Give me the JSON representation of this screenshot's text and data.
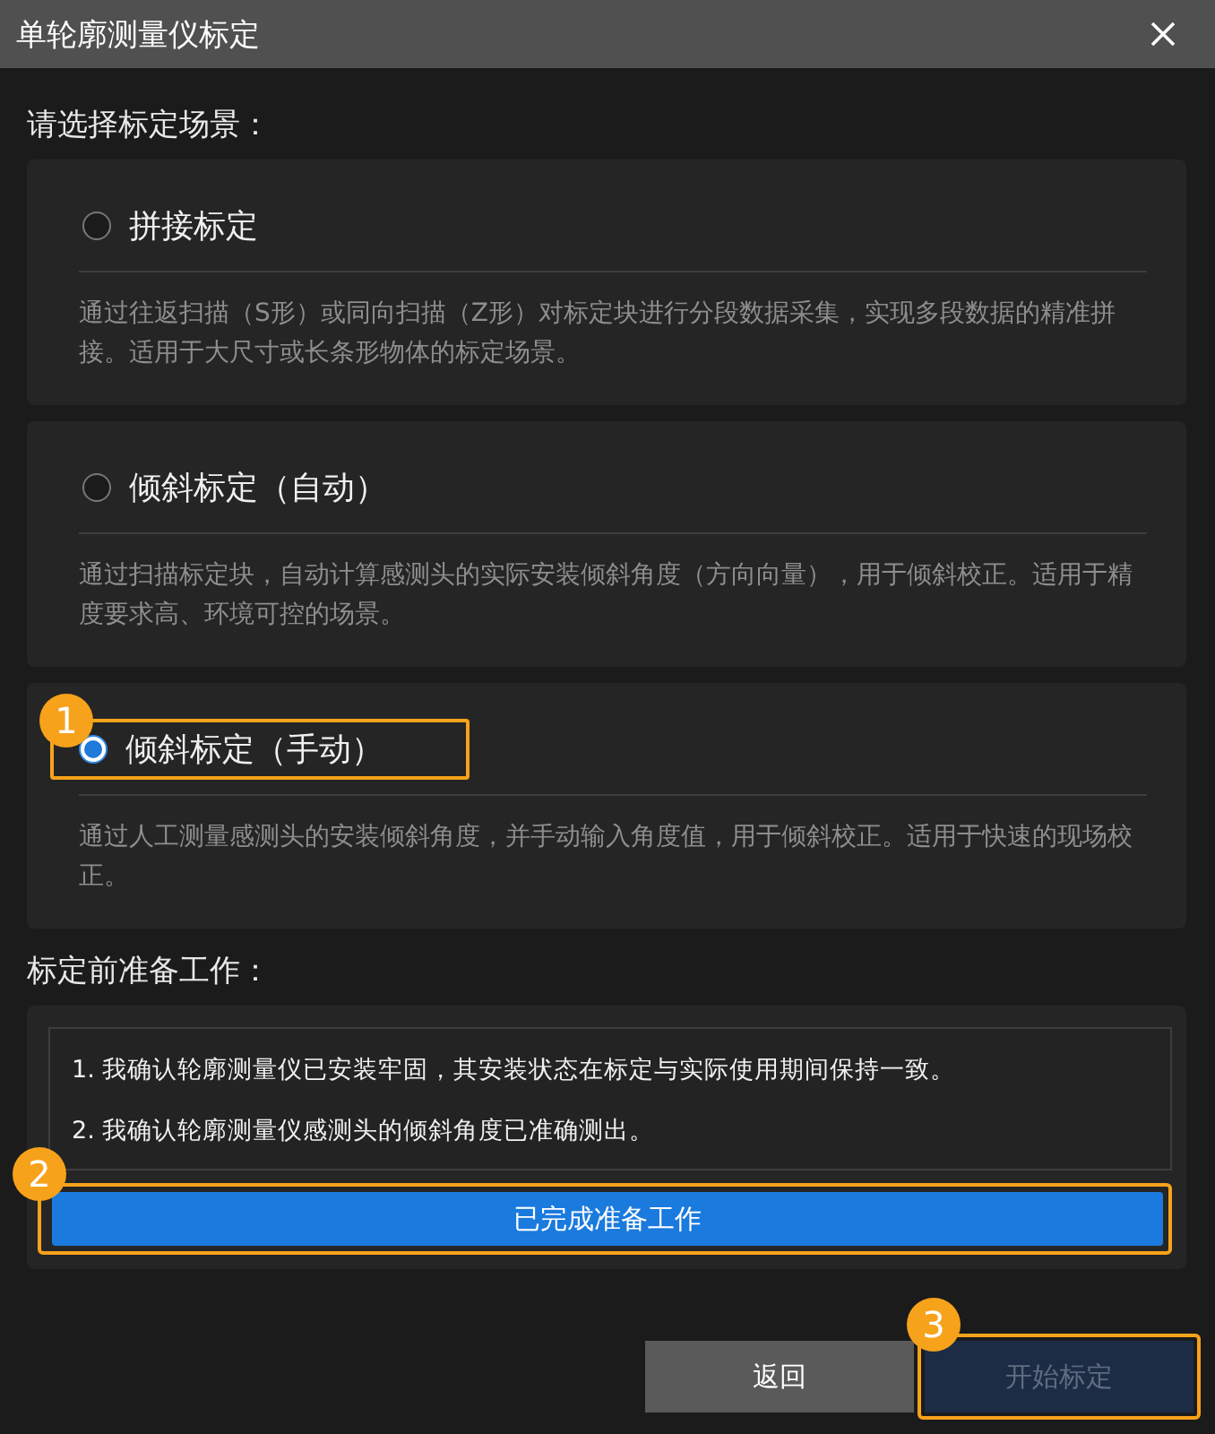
{
  "window": {
    "title": "单轮廓测量仪标定"
  },
  "scene_heading": "请选择标定场景：",
  "options": [
    {
      "label": "拼接标定",
      "description": "通过往返扫描（S形）或同向扫描（Z形）对标定块进行分段数据采集，实现多段数据的精准拼接。适用于大尺寸或长条形物体的标定场景。",
      "selected": false
    },
    {
      "label": "倾斜标定（自动）",
      "description": "通过扫描标定块，自动计算感测头的实际安装倾斜角度（方向向量），用于倾斜校正。适用于精度要求高、环境可控的场景。",
      "selected": false
    },
    {
      "label": "倾斜标定（手动）",
      "description": "通过人工测量感测头的安装倾斜角度，并手动输入角度值，用于倾斜校正。适用于快速的现场校正。",
      "selected": true,
      "marker": "1"
    }
  ],
  "prep_heading": "标定前准备工作：",
  "prep_items": [
    "1. 我确认轮廓测量仪已安装牢固，其安装状态在标定与实际使用期间保持一致。",
    "2. 我确认轮廓测量仪感测头的倾斜角度已准确测出。"
  ],
  "prep_button": {
    "label": "已完成准备工作",
    "marker": "2"
  },
  "buttons": [
    {
      "label": "返回",
      "kind": "secondary",
      "disabled": false
    },
    {
      "label": "开始标定",
      "kind": "primary",
      "disabled": true,
      "marker": "3"
    }
  ]
}
